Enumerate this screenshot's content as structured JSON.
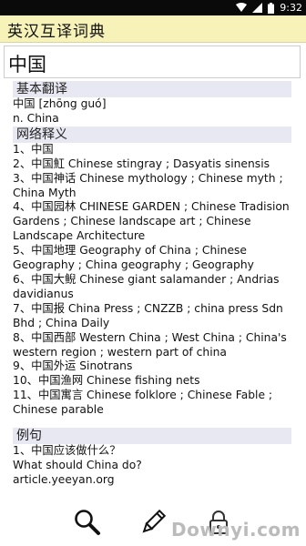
{
  "status": {
    "time": "9:32"
  },
  "app": {
    "title": "英汉互译词典"
  },
  "search": {
    "value": "中国"
  },
  "basic": {
    "header": "基本翻译",
    "pinyin": "中国 [zhōng guó]",
    "meaning": "n. China"
  },
  "web": {
    "header": "网络释义",
    "items": [
      "1、中国",
      "2、中国魟 Chinese stingray ; Dasyatis sinensis",
      "3、中国神话 Chinese mythology ; Chinese myth ; China Myth",
      "4、中国园林 CHINESE GARDEN ; Chinese Tradision Gardens ; Chinese landscape art ; Chinese Landscape Architecture",
      "5、中国地理 Geography of China ; Chinese Geography ; China geography ; Geography",
      "6、中国大鲵 Chinese giant salamander ; Andrias davidianus",
      "7、中国报 China Press ; CNZZB ; china press Sdn Bhd ; China Daily",
      "8、中国西部 Western China ; West China ; China's western region ; western part of china",
      "9、中国外运 Sinotrans",
      "10、中国渔网 Chinese fishing nets",
      "11、中国寓言 Chinese folklore ; Chinese Fable ; Chinese parable"
    ]
  },
  "examples": {
    "header": "例句",
    "items": [
      {
        "cn": "1、中国应该做什么？",
        "en": "What should China do?",
        "source": "article.yeeyan.org"
      }
    ]
  },
  "bottom": {
    "icons": [
      "search-icon",
      "pencil-icon",
      "lock-icon"
    ]
  },
  "watermark": {
    "text": "Downyi.com"
  }
}
